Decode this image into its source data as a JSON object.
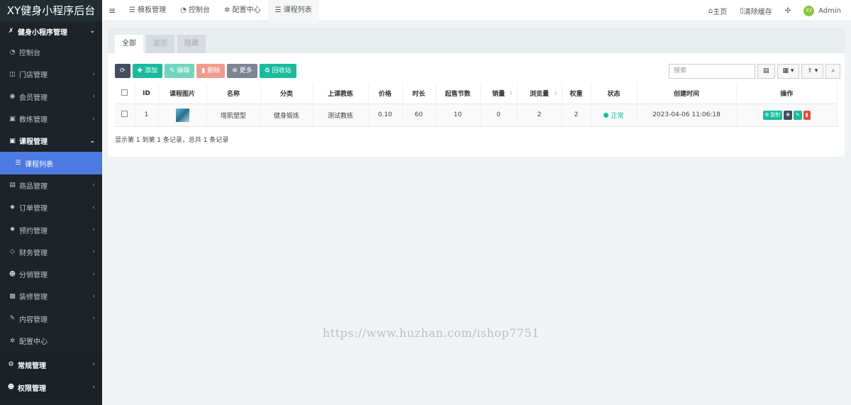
{
  "brand": "XY健身小程序后台",
  "sidebar": {
    "group_main": "健身小程序管理",
    "items": [
      {
        "label": "控制台",
        "icon": "dashboard-icon"
      },
      {
        "label": "门店管理",
        "icon": "store-icon"
      },
      {
        "label": "会员管理",
        "icon": "user-circle-icon"
      },
      {
        "label": "教练管理",
        "icon": "coach-icon"
      },
      {
        "label": "课程管理",
        "icon": "course-icon"
      },
      {
        "label": "课程列表",
        "icon": "list-icon"
      },
      {
        "label": "商品管理",
        "icon": "goods-icon"
      },
      {
        "label": "订单管理",
        "icon": "order-icon"
      },
      {
        "label": "预约管理",
        "icon": "booking-icon"
      },
      {
        "label": "财务管理",
        "icon": "diamond-icon"
      },
      {
        "label": "分销管理",
        "icon": "users-icon"
      },
      {
        "label": "装修管理",
        "icon": "picture-icon"
      },
      {
        "label": "内容管理",
        "icon": "edit-icon"
      },
      {
        "label": "配置中心",
        "icon": "gear-icon"
      }
    ],
    "group_regular": "常规管理",
    "group_permission": "权限管理"
  },
  "topbar": {
    "tabs": [
      "模板管理",
      "控制台",
      "配置中心",
      "课程列表"
    ],
    "home": "主页",
    "clear_cache": "清除缓存",
    "user": "Admin",
    "avatar_text": "XY"
  },
  "panel": {
    "tabs": [
      "全部",
      "显示",
      "隐藏"
    ],
    "toolbar": {
      "add": "添加",
      "edit": "编辑",
      "delete": "删除",
      "more": "更多",
      "recycle": "回收站"
    },
    "search_placeholder": "搜索",
    "columns": [
      "ID",
      "课程图片",
      "名称",
      "分类",
      "上课教练",
      "价格",
      "时长",
      "起售节数",
      "销量",
      "浏览量",
      "权重",
      "状态",
      "创建时间",
      "操作"
    ],
    "rows": [
      {
        "id": "1",
        "name": "增肌塑型",
        "category": "健身锻炼",
        "coach": "测试教练",
        "price": "0.10",
        "duration": "60",
        "min_sessions": "10",
        "sales": "0",
        "views": "2",
        "weight": "2",
        "status": "正常",
        "created": "2023-04-06 11:06:18",
        "copy_label": "复制"
      }
    ],
    "pagination": "显示第 1 到第 1 条记录，总共 1 条记录"
  },
  "watermark": "https://www.huzhan.com/ishop7751",
  "colors": {
    "sidebar_bg": "#1d2328",
    "active_item": "#4c7ae0",
    "success": "#18bc9c",
    "danger": "#e74c3c"
  }
}
